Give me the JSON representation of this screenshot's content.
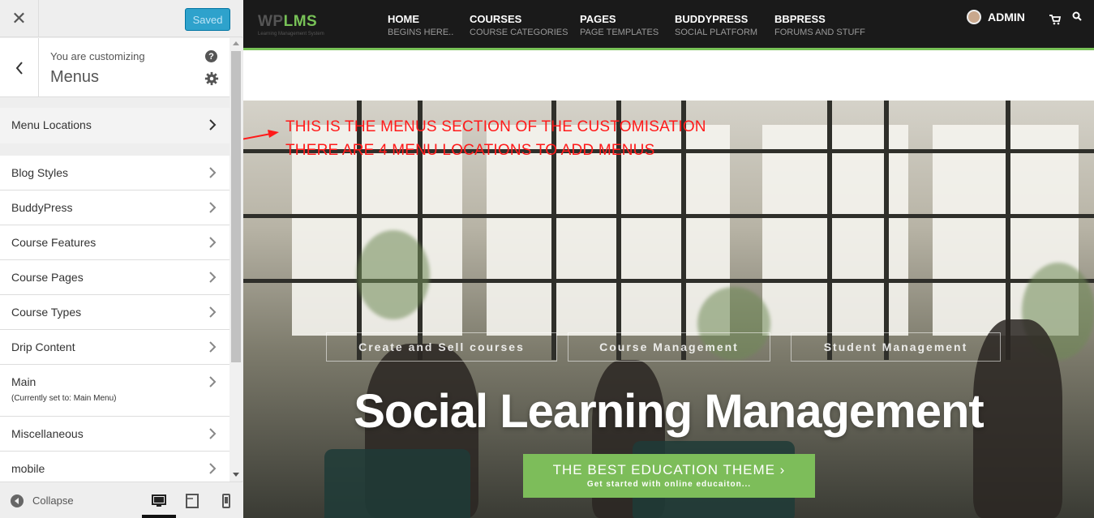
{
  "sidebar": {
    "saved_label": "Saved",
    "customizing_label": "You are customizing",
    "section_title": "Menus",
    "items": [
      {
        "label": "Menu Locations",
        "sub": ""
      },
      {
        "label": "Blog Styles",
        "sub": ""
      },
      {
        "label": "BuddyPress",
        "sub": ""
      },
      {
        "label": "Course Features",
        "sub": ""
      },
      {
        "label": "Course Pages",
        "sub": ""
      },
      {
        "label": "Course Types",
        "sub": ""
      },
      {
        "label": "Drip Content",
        "sub": ""
      },
      {
        "label": "Main",
        "sub": "(Currently set to: Main Menu)"
      },
      {
        "label": "Miscellaneous",
        "sub": ""
      },
      {
        "label": "mobile",
        "sub": ""
      }
    ],
    "collapse_label": "Collapse",
    "icons": [
      "close-icon",
      "chevron-left-icon",
      "help-icon",
      "gear-icon",
      "chevron-right-icon",
      "collapse-icon",
      "desktop-icon",
      "tablet-icon",
      "mobile-icon"
    ]
  },
  "site": {
    "logo_main_wp": "WP",
    "logo_main_lms": "LMS",
    "logo_sub": "Learning Management System",
    "nav": [
      {
        "title": "HOME",
        "sub": "BEGINS HERE.."
      },
      {
        "title": "COURSES",
        "sub": "COURSE CATEGORIES"
      },
      {
        "title": "PAGES",
        "sub": "PAGE TEMPLATES"
      },
      {
        "title": "BUDDYPRESS",
        "sub": "SOCIAL PLATFORM"
      },
      {
        "title": "BBPRESS",
        "sub": "FORUMS AND STUFF"
      }
    ],
    "admin_label": "ADMIN",
    "annotation_line1": "THIS IS THE MENUS SECTION OF THE CUSTOMISATION",
    "annotation_line2": "THERE ARE 4 MENU LOCATIONS TO ADD MENUS",
    "tags": [
      "Create and Sell courses",
      "Course Management",
      "Student Management"
    ],
    "hero_title": "Social Learning Management",
    "cta_title": "THE BEST EDUCATION THEME ›",
    "cta_sub": "Get started with online educaiton...",
    "accent_color": "#78c257",
    "annotation_color": "#ff1a1a"
  }
}
